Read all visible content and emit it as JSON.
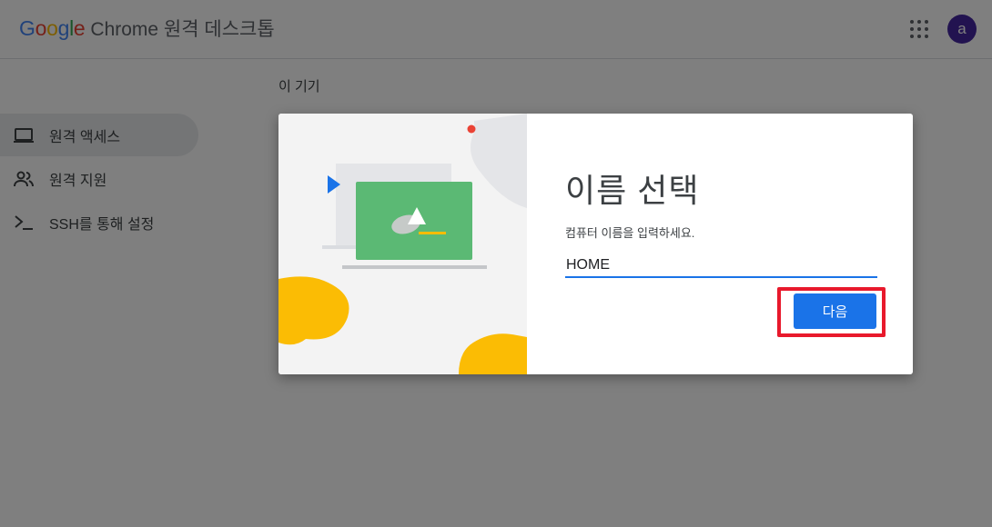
{
  "header": {
    "logo_text": "Google",
    "product": "Chrome 원격 데스크톱",
    "avatar_letter": "a"
  },
  "nav": {
    "items": [
      {
        "label": "원격 액세스",
        "icon": "laptop-icon",
        "active": true
      },
      {
        "label": "원격 지원",
        "icon": "people-icon",
        "active": false
      },
      {
        "label": "SSH를 통해 설정",
        "icon": "terminal-icon",
        "active": false
      }
    ]
  },
  "main": {
    "section_title": "이 기기"
  },
  "dialog": {
    "title": "이름 선택",
    "description": "컴퓨터 이름을 입력하세요.",
    "input_value": "HOME",
    "next_label": "다음"
  },
  "colors": {
    "accent": "#1a73e8",
    "highlight": "#e8192c",
    "avatar": "#4527a0",
    "illustration_green": "#5bb974",
    "illustration_yellow": "#fbbc04"
  }
}
